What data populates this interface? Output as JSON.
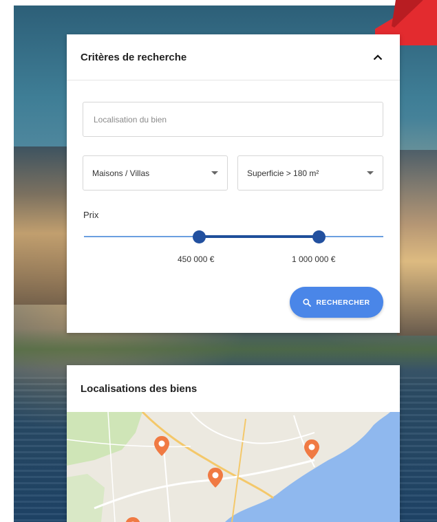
{
  "search": {
    "title": "Critères de recherche",
    "collapse_icon": "chevron-up-icon",
    "location_placeholder": "Localisation du bien",
    "location_value": "",
    "property_type": "Maisons / Villas",
    "surface": "Superficie > 180 m²",
    "price_label": "Prix",
    "price_min": "450 000 €",
    "price_max": "1 000 000 €",
    "slider_min_fraction": 0.385,
    "slider_max_fraction": 0.785,
    "button_label": "RECHERCHER",
    "button_icon": "search-icon"
  },
  "map": {
    "title": "Localisations des biens",
    "marker_icon": "map-pin-icon"
  },
  "colors": {
    "accent": "#4a86e8",
    "slider_dark": "#22509f",
    "slider_light": "#6a9fe0",
    "marker": "#f07a43",
    "logo_red": "#e32b2f",
    "sea": "#8fb8ee"
  }
}
